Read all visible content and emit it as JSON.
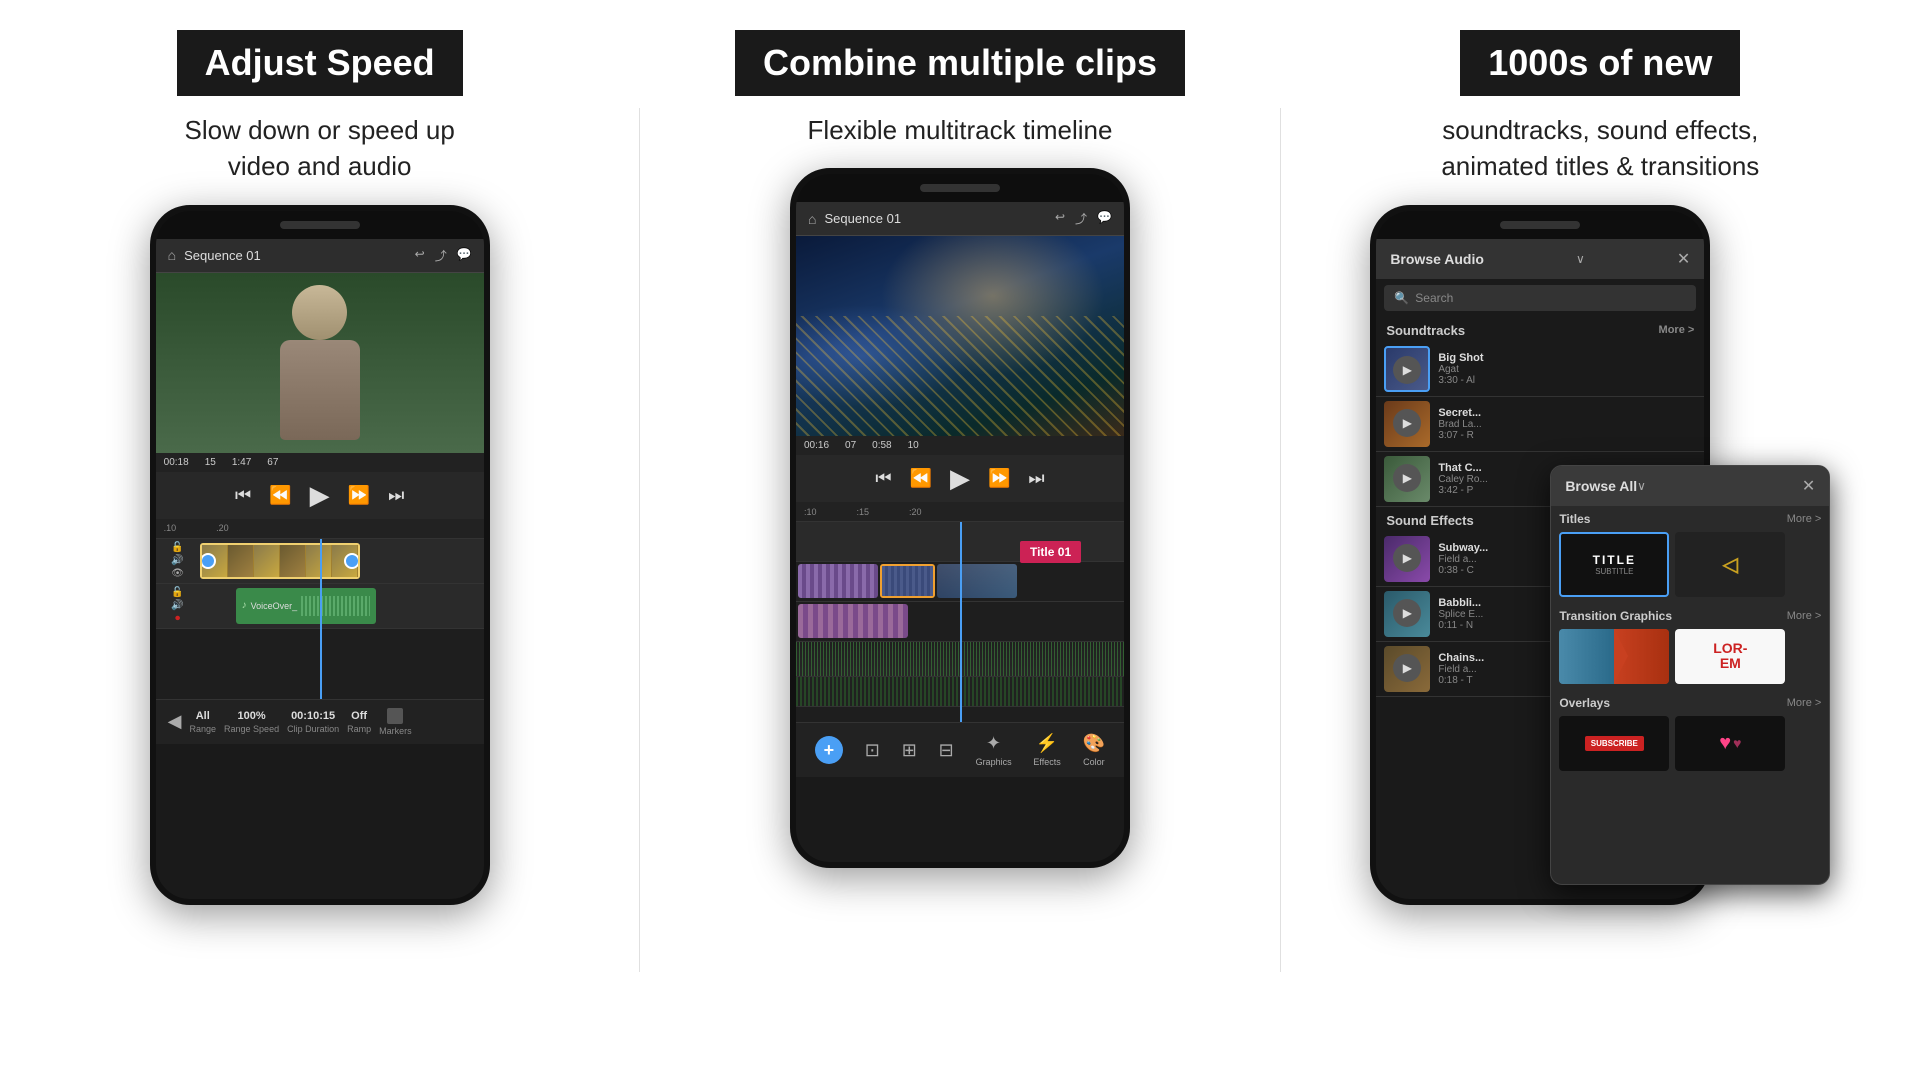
{
  "sections": [
    {
      "id": "adjust-speed",
      "title": "Adjust Speed",
      "subtitle": "Slow down or speed up\nvideo and audio",
      "phone": {
        "sequence": "Sequence 01",
        "time1": "00:18",
        "time2": "15",
        "time3": "1:47",
        "time4": "67",
        "timeline_marks": [
          ".10",
          ".20"
        ],
        "bottom_controls": [
          "All",
          "100%",
          "00:10:15",
          "Off"
        ],
        "bottom_labels": [
          "Range",
          "Range Speed",
          "Clip Duration",
          "Ramp",
          "Markers"
        ]
      }
    },
    {
      "id": "combine-clips",
      "title": "Combine multiple clips",
      "subtitle": "Flexible multitrack timeline",
      "phone": {
        "sequence": "Sequence 01",
        "time1": "00:16",
        "time2": "07",
        "time3": "0:58",
        "time4": "10",
        "title_overlay": "Title 01",
        "nav_items": [
          "Graphics",
          "Effects",
          "Color"
        ]
      }
    },
    {
      "id": "new-content",
      "title": "1000s of new",
      "subtitle": "soundtracks, sound effects,\nanimated titles & transitions",
      "phone": {
        "browse_title": "Browse Audio",
        "search_placeholder": "Search",
        "soundtracks_label": "Soundtracks",
        "more_label": "More",
        "tracks": [
          {
            "name": "Big Shot",
            "meta": "Agat\n3:30 - Al"
          },
          {
            "name": "Secret...",
            "meta": "Brad La...\n3:07 - R"
          },
          {
            "name": "That C...",
            "meta": "Caley Ro...\n3:42 - P"
          }
        ],
        "sound_effects_label": "Sound Effects",
        "effects": [
          {
            "name": "Subway...",
            "meta": "Field a...\n0:38 - C"
          },
          {
            "name": "Babbli...",
            "meta": "Splice E...\n0:11 - N"
          },
          {
            "name": "Chains...",
            "meta": "Field a...\n0:18 - T"
          }
        ],
        "overlay_browse_title": "Browse All",
        "titles_label": "Titles",
        "titles_more": "More",
        "title_card_1": {
          "main": "TITLE",
          "sub": "SUBTITLE"
        },
        "transition_label": "Transition Graphics",
        "transition_more": "More",
        "overlays_label": "Overlays",
        "overlays_more": "More",
        "subscribe_text": "SUBSCRIBE",
        "lorem_text": "LOR-\nEM"
      }
    }
  ]
}
